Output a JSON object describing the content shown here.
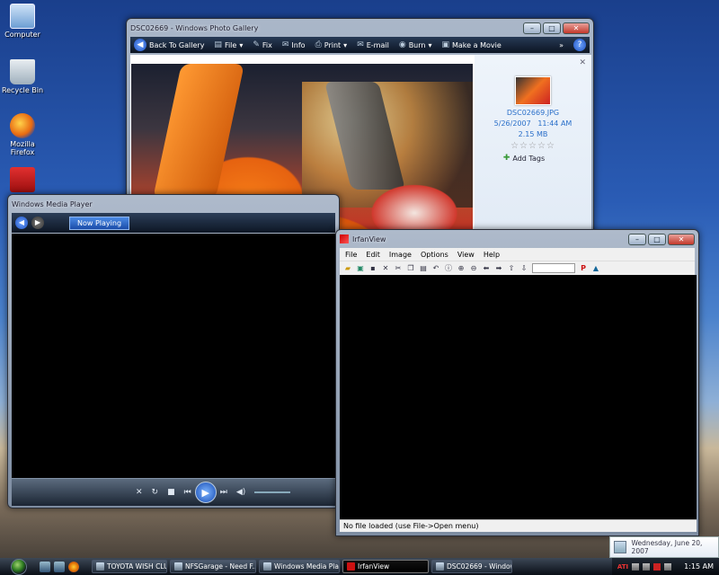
{
  "desktop": {
    "icons": [
      {
        "label": "Computer"
      },
      {
        "label": "Recycle Bin"
      },
      {
        "label": "Mozilla Firefox"
      },
      {
        "label": ""
      }
    ]
  },
  "gallery": {
    "title": "DSC02669 - Windows Photo Gallery",
    "toolbar": {
      "back": "Back To Gallery",
      "file": "File",
      "fix": "Fix",
      "info": "Info",
      "print": "Print",
      "email": "E-mail",
      "burn": "Burn",
      "movie": "Make a Movie"
    },
    "info": {
      "filename": "DSC02669.JPG",
      "date": "5/26/2007",
      "time": "11:44 AM",
      "size": "2.15 MB",
      "rating": 0,
      "add_tags": "Add Tags"
    }
  },
  "wmp": {
    "title": "Windows Media Player",
    "now_playing": "Now Playing"
  },
  "irfan": {
    "title": "IrfanView",
    "menu": [
      "File",
      "Edit",
      "Image",
      "Options",
      "View",
      "Help"
    ],
    "status": "No file loaded (use File->Open menu)"
  },
  "clock_tooltip": "Wednesday, June 20, 2007",
  "taskbar": {
    "buttons": [
      {
        "label": "TOYOTA WISH CLU...",
        "active": false
      },
      {
        "label": "NFSGarage - Need F...",
        "active": false
      },
      {
        "label": "Windows Media Pla...",
        "active": false
      },
      {
        "label": "IrfanView",
        "active": true
      },
      {
        "label": "DSC02669 - Window...",
        "active": false
      }
    ],
    "tray_label": "ATI",
    "time": "1:15 AM"
  }
}
